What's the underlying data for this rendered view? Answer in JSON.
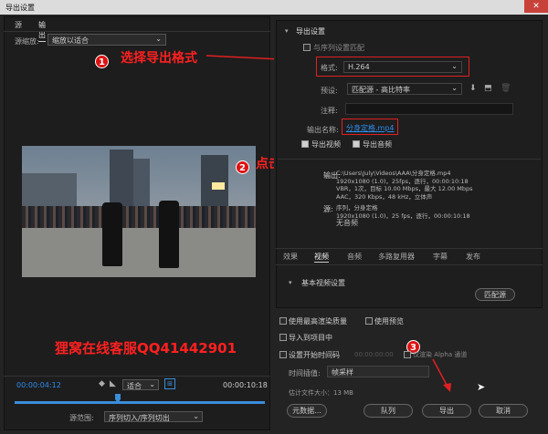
{
  "window": {
    "title": "导出设置",
    "close_glyph": "✕"
  },
  "left": {
    "tabs": [
      "源",
      "输出"
    ],
    "source_scale_label": "源缩放:",
    "source_scale_value": "缩放以适合",
    "timecode_start": "00:00:04:12",
    "timecode_end": "00:00:10:18",
    "fit_value": "适合",
    "source_range_label": "源范围:",
    "source_range_value": "序列切入/序列切出"
  },
  "annotations": {
    "step1": "选择导出格式",
    "step2": "点击更改视频名称",
    "watermark": "狸窝在线客服QQ41442901",
    "badge1": "1",
    "badge2": "2",
    "badge3": "3"
  },
  "export": {
    "section_title": "导出设置",
    "match_sequence": "与序列设置匹配",
    "format_label": "格式:",
    "format_value": "H.264",
    "preset_label": "预设:",
    "preset_value": "匹配源 - 高比特率",
    "comment_label": "注释:",
    "output_name_label": "输出名称:",
    "output_name_value": "分身定格.mp4",
    "export_video": "导出视频",
    "export_audio": "导出音频"
  },
  "summary": {
    "output_label": "输出:",
    "output_lines": [
      "C:\\Users\\July\\Videos\\AAA\\分身定格.mp4",
      "1920x1080 (1.0)，25fps，逐行，00:00:10:18",
      "VBR，1次，目标 10.00 Mbps，最大 12.00 Mbps",
      "AAC，320 Kbps，48 kHz，立体声"
    ],
    "source_label": "源:",
    "source_lines": [
      "序列，分身定格",
      "1920x1080 (1.0)，25 fps，逐行，00:00:10:18",
      "无音频"
    ]
  },
  "settings_tabs": [
    "效果",
    "视频",
    "音频",
    "多路复用器",
    "字幕",
    "发布"
  ],
  "video_settings": {
    "title": "基本视频设置",
    "match_source_button": "匹配源"
  },
  "bottom": {
    "max_render": "使用最高渲染质量",
    "use_preview": "使用预览",
    "import_project": "导入到项目中",
    "set_start_timecode": "设置开始时间码",
    "start_timecode": "00:00:00:00",
    "render_alpha": "仅渲染 Alpha 通道",
    "interp_label": "时间插值:",
    "interp_value": "帧采样",
    "file_size": "估计文件大小：13 MB",
    "metadata_button": "元数据...",
    "queue_button": "队列",
    "export_button": "导出",
    "cancel_button": "取消"
  }
}
